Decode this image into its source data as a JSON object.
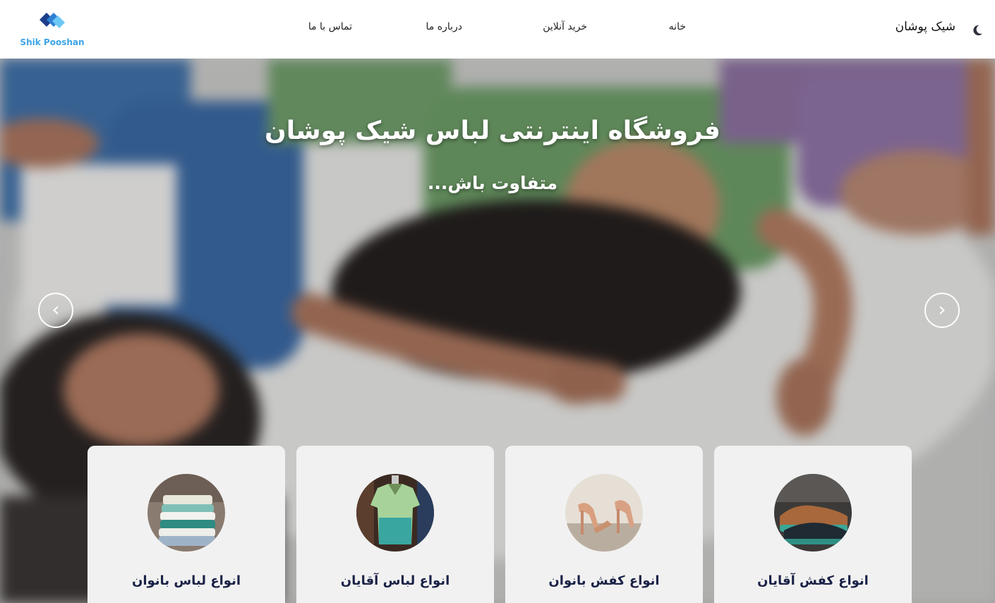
{
  "header": {
    "logo_text": "Shik Pooshan",
    "brand_name": "شیک پوشان",
    "nav": {
      "home": "خانه",
      "shop": "خرید آنلاین",
      "about": "درباره ما",
      "contact": "تماس با ما"
    },
    "theme_icon": "moon-icon"
  },
  "hero": {
    "title": "فروشگاه اینترنتی لباس شیک پوشان",
    "subtitle": "متفاوت باش...",
    "prev_arrow": "‹",
    "next_arrow": "›"
  },
  "categories": [
    {
      "label": "انواع لباس بانوان",
      "icon": "folded-clothes-image"
    },
    {
      "label": "انواع لباس آقایان",
      "icon": "shirt-image"
    },
    {
      "label": "انواع کفش بانوان",
      "icon": "heels-image"
    },
    {
      "label": "انواع کفش آقایان",
      "icon": "shoes-image"
    }
  ],
  "colors": {
    "logo_blue": "#3ba4e8",
    "logo_navy": "#1d3f8c",
    "card_bg": "#f1f1f1",
    "card_text": "#1a2246"
  }
}
